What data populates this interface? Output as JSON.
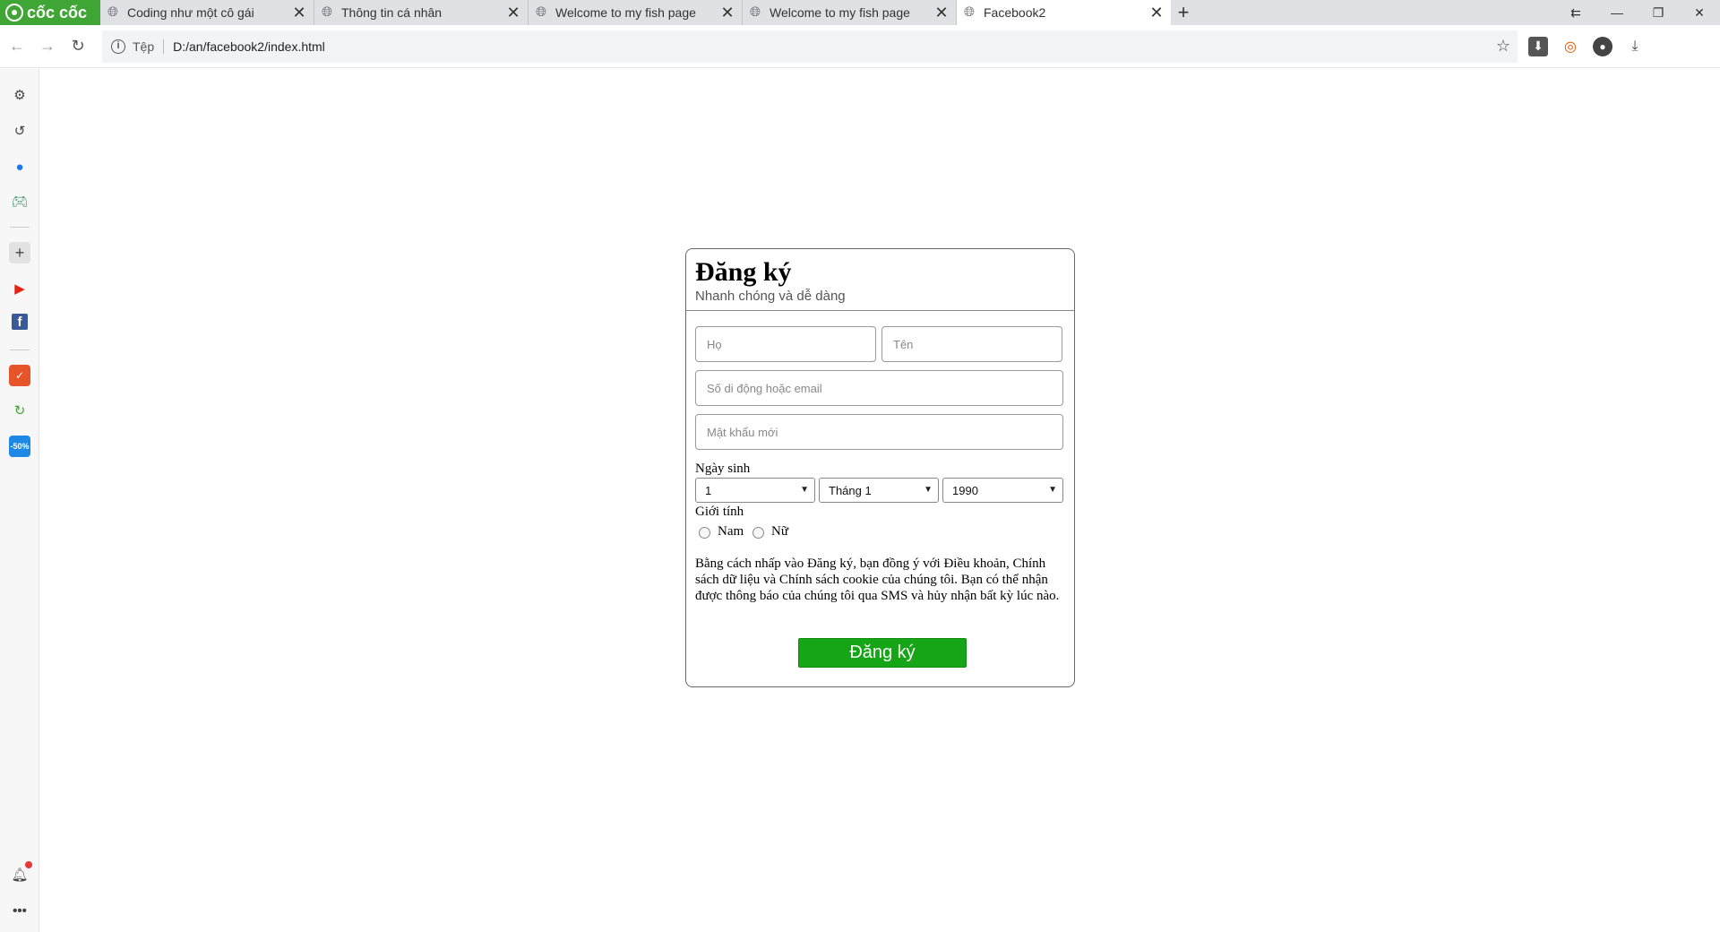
{
  "browser": {
    "brand": "cốc cốc",
    "tabs": [
      {
        "title": "Coding như một cô gái",
        "active": false
      },
      {
        "title": "Thông tin cá nhân",
        "active": false
      },
      {
        "title": "Welcome to my fish page",
        "active": false
      },
      {
        "title": "Welcome to my fish page",
        "active": false
      },
      {
        "title": "Facebook2",
        "active": true
      }
    ],
    "address": {
      "scheme_label": "Tệp",
      "url": "D:/an/facebook2/index.html"
    },
    "icons": {
      "back": "arrow-left-icon",
      "forward": "arrow-right-icon",
      "reload": "reload-icon",
      "bookmark": "star-icon",
      "download_box": "download-box-icon",
      "coccoc": "coccoc-icon",
      "account": "account-icon",
      "download": "download-icon"
    }
  },
  "sidebar": {
    "items": [
      "gear-icon",
      "history-icon",
      "messenger-icon",
      "gamepad-icon",
      "plus-icon",
      "youtube-icon",
      "facebook-icon",
      "shopping-icon",
      "refresh-leaf-icon",
      "sale-icon",
      "bell-icon",
      "more-icon"
    ],
    "sale_text": "-50%"
  },
  "form": {
    "title": "Đăng ký",
    "subtitle": "Nhanh chóng và dễ dàng",
    "fields": {
      "last_name_placeholder": "Họ",
      "first_name_placeholder": "Tên",
      "contact_placeholder": "Số di động hoặc email",
      "password_placeholder": "Mật khẩu mới"
    },
    "birthday_label": "Ngày sinh",
    "birthday": {
      "day": "1",
      "month": "Tháng 1",
      "year": "1990"
    },
    "gender_label": "Giới tính",
    "gender_options": [
      "Nam",
      "Nữ"
    ],
    "terms": "Bằng cách nhấp vào Đăng ký, bạn đồng ý với Điều khoản, Chính sách dữ liệu và Chính sách cookie của chúng tôi. Bạn có thể nhận được thông báo của chúng tôi qua SMS và hủy nhận bất kỳ lúc nào.",
    "submit_label": "Đăng ký",
    "colors": {
      "submit_bg": "#16a516",
      "border": "#666666"
    }
  }
}
